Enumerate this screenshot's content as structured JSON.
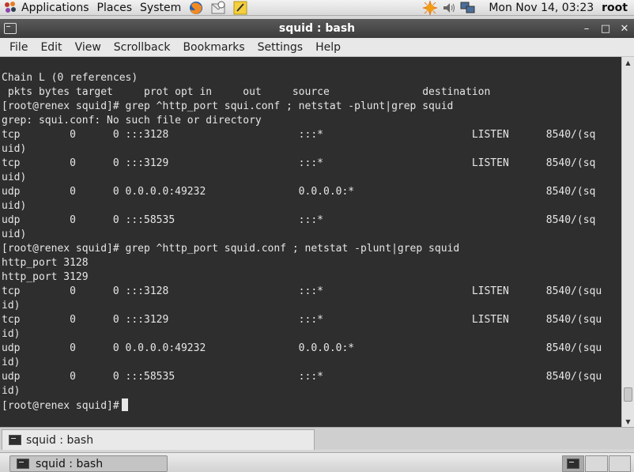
{
  "top_panel": {
    "menus": [
      "Applications",
      "Places",
      "System"
    ],
    "clock": "Mon Nov 14, 03:23",
    "user": "root"
  },
  "window": {
    "title": "squid : bash"
  },
  "menubar": {
    "items": [
      "File",
      "Edit",
      "View",
      "Scrollback",
      "Bookmarks",
      "Settings",
      "Help"
    ]
  },
  "terminal": {
    "lines": [
      "",
      "Chain L (0 references)",
      " pkts bytes target     prot opt in     out     source               destination",
      "[root@renex squid]# grep ^http_port squi.conf ; netstat -plunt|grep squid",
      "grep: squi.conf: No such file or directory",
      "tcp        0      0 :::3128                     :::*                        LISTEN      8540/(sq",
      "uid)",
      "tcp        0      0 :::3129                     :::*                        LISTEN      8540/(sq",
      "uid)",
      "udp        0      0 0.0.0.0:49232               0.0.0.0:*                               8540/(sq",
      "uid)",
      "udp        0      0 :::58535                    :::*                                    8540/(sq",
      "uid)",
      "[root@renex squid]# grep ^http_port squid.conf ; netstat -plunt|grep squid",
      "http_port 3128",
      "http_port 3129",
      "tcp        0      0 :::3128                     :::*                        LISTEN      8540/(squ",
      "id)",
      "tcp        0      0 :::3129                     :::*                        LISTEN      8540/(squ",
      "id)",
      "udp        0      0 0.0.0.0:49232               0.0.0.0:*                               8540/(squ",
      "id)",
      "udp        0      0 :::58535                    :::*                                    8540/(squ",
      "id)"
    ],
    "prompt": "[root@renex squid]#"
  },
  "tab": {
    "label": "squid : bash"
  },
  "taskbar": {
    "task_label": "squid : bash"
  }
}
